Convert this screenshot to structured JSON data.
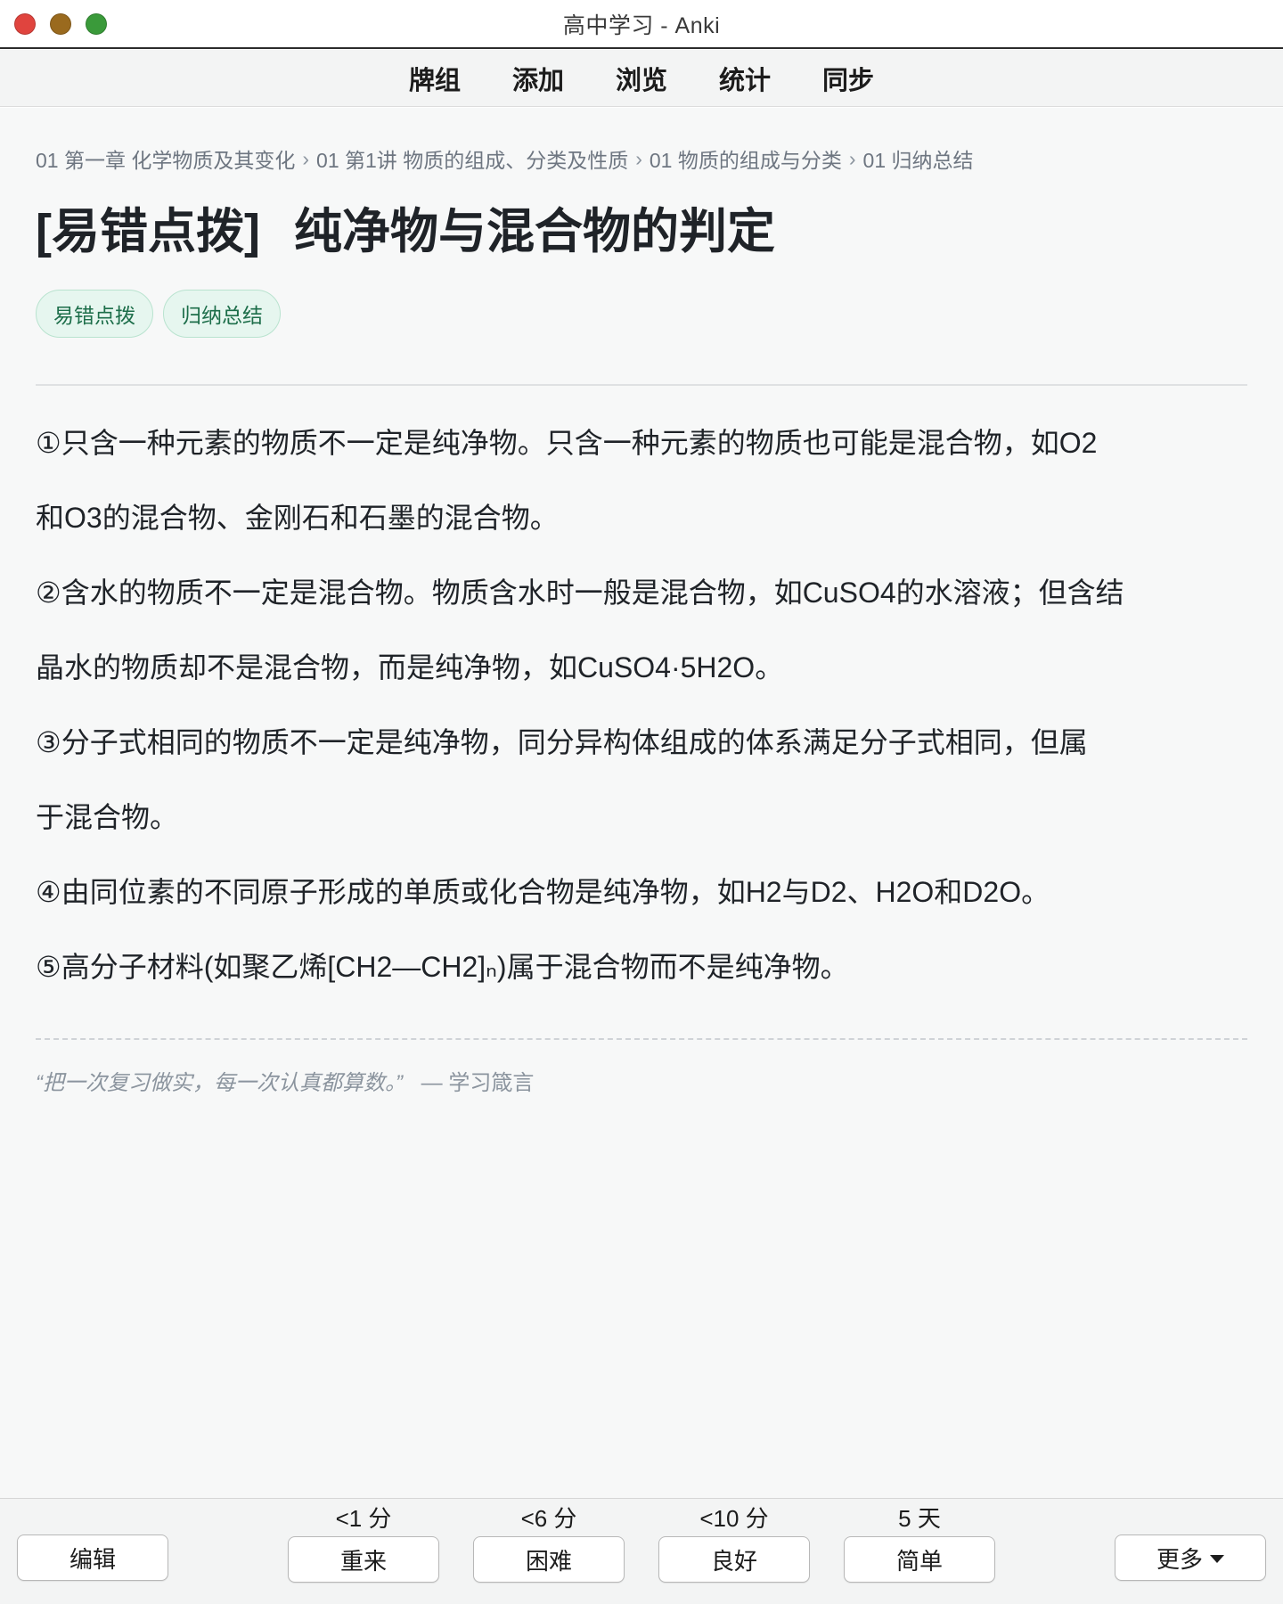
{
  "window": {
    "title": "高中学习 - Anki"
  },
  "toolbar": {
    "items": [
      "牌组",
      "添加",
      "浏览",
      "统计",
      "同步"
    ]
  },
  "breadcrumb": [
    "01 第一章 化学物质及其变化",
    "01 第1讲 物质的组成、分类及性质",
    "01 物质的组成与分类",
    "01 归纳总结"
  ],
  "breadcrumb_separator": "›",
  "card": {
    "title_prefix": "[易错点拨]",
    "title_main": "纯净物与混合物的判定",
    "tags": [
      "易错点拨",
      "归纳总结"
    ],
    "paragraphs": [
      "①只含一种元素的物质不一定是纯净物。只含一种元素的物质也可能是混合物，如O2",
      "和O3的混合物、金刚石和石墨的混合物。",
      "②含水的物质不一定是混合物。物质含水时一般是混合物，如CuSO4的水溶液；但含结",
      "晶水的物质却不是混合物，而是纯净物，如CuSO4·5H2O。",
      "③分子式相同的物质不一定是纯净物，同分异构体组成的体系满足分子式相同，但属",
      "于混合物。",
      "④由同位素的不同原子形成的单质或化合物是纯净物，如H2与D2、H2O和D2O。",
      "⑤高分子材料(如聚乙烯[CH2—CH2]ₙ)属于混合物而不是纯净物。"
    ],
    "quote": {
      "text": "“把一次复习做实，每一次认真都算数。”",
      "source": "— 学习箴言"
    }
  },
  "bottom": {
    "edit_label": "编辑",
    "answers": [
      {
        "interval": "<1 分",
        "label": "重来"
      },
      {
        "interval": "<6 分",
        "label": "困难"
      },
      {
        "interval": "<10 分",
        "label": "良好"
      },
      {
        "interval": "5 天",
        "label": "简单"
      }
    ],
    "more_label": "更多"
  },
  "colors": {
    "tag_bg": "#e6f6ef",
    "tag_text": "#1d6e4a",
    "close": "#e0443e",
    "minimize": "#9a6a1e",
    "zoom": "#3a9a3a"
  }
}
